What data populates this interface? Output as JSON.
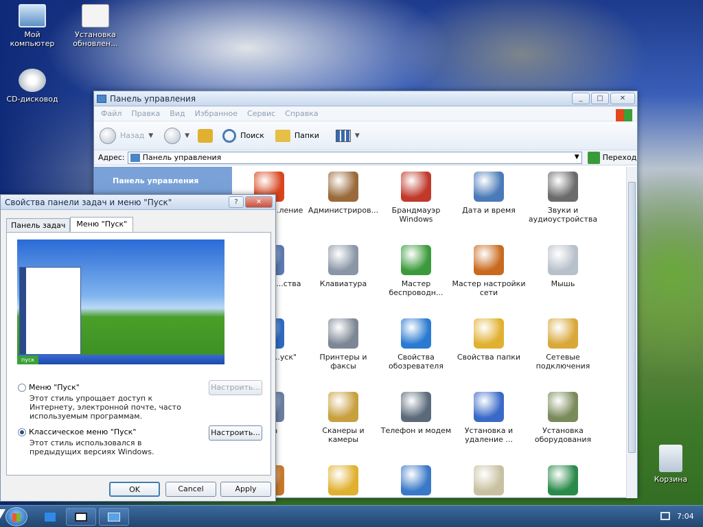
{
  "desktop": {
    "icons": [
      {
        "label": "Мой компьютер",
        "icon": "my-computer-icon"
      },
      {
        "label": "Установка обновлен...",
        "icon": "update-install-icon"
      },
      {
        "label": "CD-дисковод",
        "icon": "dvd-drive-icon"
      },
      {
        "label": "Корзина",
        "icon": "recycle-bin-icon"
      }
    ]
  },
  "control_panel": {
    "title": "Панель управления",
    "menu": [
      "Файл",
      "Правка",
      "Вид",
      "Избранное",
      "Сервис",
      "Справка"
    ],
    "toolbar": {
      "back": "Назад",
      "search": "Поиск",
      "folders": "Папки"
    },
    "address_label": "Адрес:",
    "address_value": "Панель управления",
    "go_label": "Переход",
    "sidebar_title": "Панель управления",
    "items": [
      {
        "label": "...ческое ...ление",
        "icon": "windows-flag-icon",
        "color": "#d9441c"
      },
      {
        "label": "Администриров...",
        "icon": "admin-tools-icon",
        "color": "#9a6a3a"
      },
      {
        "label": "Брандмауэр Windows",
        "icon": "firewall-icon",
        "color": "#c0392b"
      },
      {
        "label": "Дата и время",
        "icon": "date-time-icon",
        "color": "#4a7ab8"
      },
      {
        "label": "Звуки и аудиоустройства",
        "icon": "speaker-icon",
        "color": "#6b6b6b"
      },
      {
        "label": "...ертные ...ства",
        "icon": "fonts-icon",
        "color": "#5a7ab0"
      },
      {
        "label": "Клавиатура",
        "icon": "keyboard-icon",
        "color": "#8a96a6"
      },
      {
        "label": "Мастер беспроводн...",
        "icon": "wireless-icon",
        "color": "#3c9a3c"
      },
      {
        "label": "Мастер настройки сети",
        "icon": "network-home-icon",
        "color": "#c86a1e"
      },
      {
        "label": "Мышь",
        "icon": "mouse-icon",
        "color": "#b8c0ca"
      },
      {
        "label": "...дач и ...уск\"",
        "icon": "taskbar-icon",
        "color": "#2d6ac0"
      },
      {
        "label": "Принтеры и факсы",
        "icon": "printer-icon",
        "color": "#7d8794"
      },
      {
        "label": "Свойства обозревателя",
        "icon": "internet-options-icon",
        "color": "#2a7ad2"
      },
      {
        "label": "Свойства папки",
        "icon": "folder-options-icon",
        "color": "#e0b030"
      },
      {
        "label": "Сетевые подключения",
        "icon": "network-connections-icon",
        "color": "#d9a83a"
      },
      {
        "label": "...на",
        "icon": "system-icon",
        "color": "#6a7ea0"
      },
      {
        "label": "Сканеры и камеры",
        "icon": "scanner-camera-icon",
        "color": "#c8a040"
      },
      {
        "label": "Телефон и модем",
        "icon": "phone-modem-icon",
        "color": "#5a6a7a"
      },
      {
        "label": "Установка и удаление ...",
        "icon": "add-remove-icon",
        "color": "#3a6ac8"
      },
      {
        "label": "Установка оборудования",
        "icon": "hardware-icon",
        "color": "#7a8a5a"
      },
      {
        "label": "",
        "icon": "users-icon",
        "color": "#c8782a"
      },
      {
        "label": "",
        "icon": "scheduled-tasks-icon",
        "color": "#e0b030"
      },
      {
        "label": "",
        "icon": "display-icon",
        "color": "#3a78c8"
      },
      {
        "label": "",
        "icon": "power-options-icon",
        "color": "#c8c0a0"
      },
      {
        "label": "",
        "icon": "regional-icon",
        "color": "#2a8a4a"
      }
    ]
  },
  "dialog": {
    "title": "Свойства панели задач и меню \"Пуск\"",
    "tabs": [
      "Панель задач",
      "Меню \"Пуск\""
    ],
    "preview_start": "пуск",
    "option1": {
      "label": "Меню \"Пуск\"",
      "desc": "Этот стиль упрощает доступ к Интернету, электронной почте, часто используемым программам.",
      "button": "Настроить...",
      "selected": false
    },
    "option2": {
      "label": "Классическое меню \"Пуск\"",
      "desc": "Этот стиль использовался в предыдущих версиях Windows.",
      "button": "Настроить...",
      "selected": true
    },
    "ok": "OK",
    "cancel": "Cancel",
    "apply": "Apply"
  },
  "taskbar": {
    "clock": "7:04"
  }
}
